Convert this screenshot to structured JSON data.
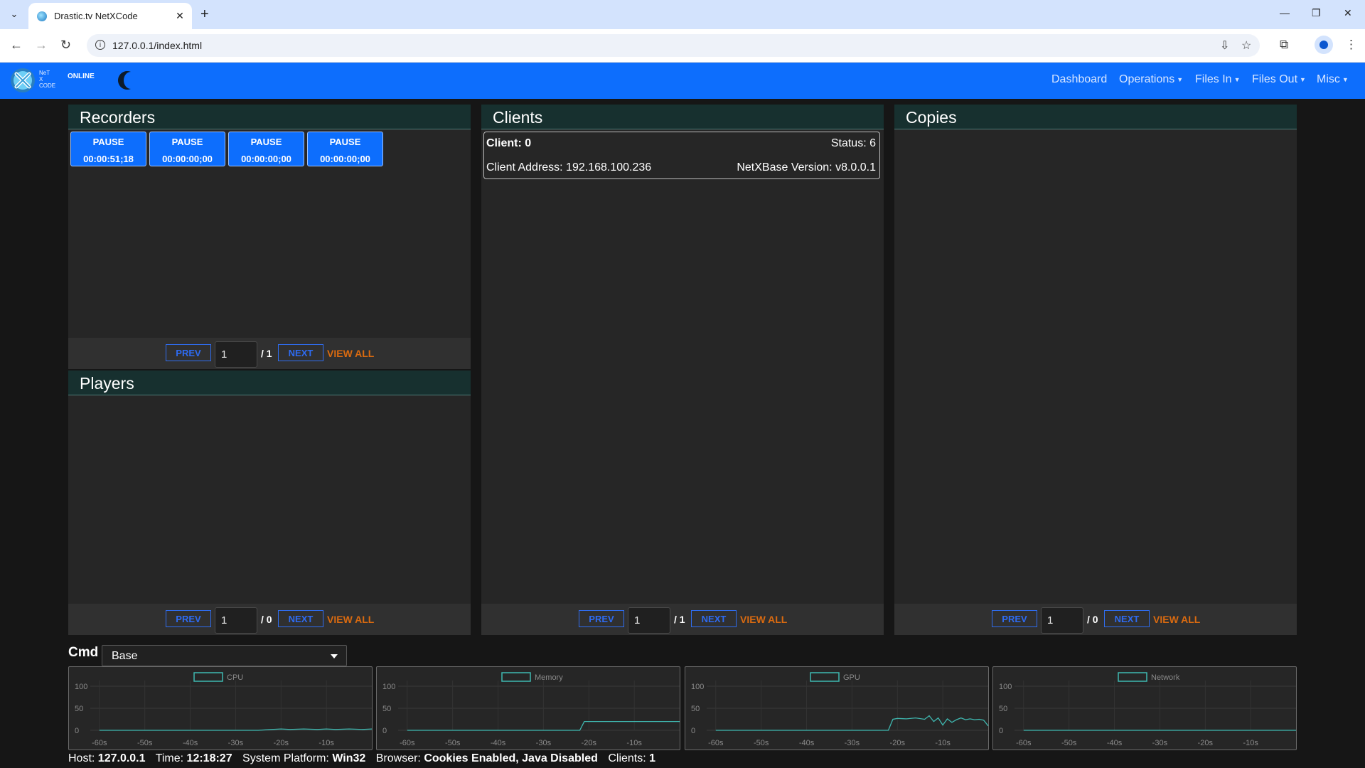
{
  "browser": {
    "tab_title": "Drastic.tv NetXCode",
    "url": "127.0.0.1/index.html"
  },
  "app": {
    "logo_text": [
      "NeT",
      "X",
      "CODE"
    ],
    "status": "ONLINE",
    "nav": {
      "dashboard": "Dashboard",
      "operations": "Operations",
      "files_in": "Files In",
      "files_out": "Files Out",
      "misc": "Misc"
    }
  },
  "recorders": {
    "title": "Recorders",
    "buttons": [
      {
        "state": "PAUSE",
        "timecode": "00:00:51;18"
      },
      {
        "state": "PAUSE",
        "timecode": "00:00:00;00"
      },
      {
        "state": "PAUSE",
        "timecode": "00:00:00;00"
      },
      {
        "state": "PAUSE",
        "timecode": "00:00:00;00"
      }
    ],
    "pager": {
      "prev": "PREV",
      "page": "1",
      "total": "/ 1",
      "next": "NEXT",
      "view_all": "VIEW ALL"
    }
  },
  "players": {
    "title": "Players",
    "pager": {
      "prev": "PREV",
      "page": "1",
      "total": "/ 0",
      "next": "NEXT",
      "view_all": "VIEW ALL"
    }
  },
  "clients": {
    "title": "Clients",
    "card": {
      "client": "Client: 0",
      "status": "Status: 6",
      "address": "Client Address: 192.168.100.236",
      "version": "NetXBase Version: v8.0.0.1"
    },
    "pager": {
      "prev": "PREV",
      "page": "1",
      "total": "/ 1",
      "next": "NEXT",
      "view_all": "VIEW ALL"
    }
  },
  "copies": {
    "title": "Copies",
    "pager": {
      "prev": "PREV",
      "page": "1",
      "total": "/ 0",
      "next": "NEXT",
      "view_all": "VIEW ALL"
    }
  },
  "cmd": {
    "label": "Cmd",
    "selected": "Base"
  },
  "chart_data": [
    {
      "type": "line",
      "series": [
        {
          "name": "CPU",
          "x": [
            -60,
            -55,
            -50,
            -45,
            -40,
            -35,
            -30,
            -25,
            -22,
            -20,
            -18,
            -15,
            -12,
            -10,
            -8,
            -5,
            -2,
            0
          ],
          "values": [
            0,
            0,
            0,
            0,
            0,
            0,
            0,
            0,
            2,
            3,
            2,
            3,
            2,
            3,
            2,
            3,
            2,
            3
          ]
        }
      ],
      "xticks": [
        "-60s",
        "-50s",
        "-40s",
        "-30s",
        "-20s",
        "-10s"
      ],
      "yticks": [
        "100",
        "50",
        "0"
      ],
      "ylim": [
        0,
        100
      ],
      "color": "#3fb8b0"
    },
    {
      "type": "line",
      "series": [
        {
          "name": "Memory",
          "x": [
            -60,
            -50,
            -40,
            -30,
            -22,
            -21,
            -20,
            -10,
            0
          ],
          "values": [
            0,
            0,
            0,
            0,
            0,
            20,
            20,
            20,
            20
          ]
        }
      ],
      "xticks": [
        "-60s",
        "-50s",
        "-40s",
        "-30s",
        "-20s",
        "-10s"
      ],
      "yticks": [
        "100",
        "50",
        "0"
      ],
      "ylim": [
        0,
        100
      ],
      "color": "#3fb8b0"
    },
    {
      "type": "line",
      "series": [
        {
          "name": "GPU",
          "x": [
            -60,
            -50,
            -40,
            -30,
            -22,
            -21,
            -20,
            -18,
            -16,
            -14,
            -13,
            -12,
            -11,
            -10,
            -9,
            -8,
            -7,
            -6,
            -5,
            -4,
            -3,
            -2,
            -1,
            0
          ],
          "values": [
            0,
            0,
            0,
            0,
            0,
            25,
            27,
            26,
            28,
            25,
            33,
            20,
            28,
            12,
            26,
            18,
            24,
            28,
            24,
            26,
            24,
            25,
            23,
            10
          ]
        }
      ],
      "xticks": [
        "-60s",
        "-50s",
        "-40s",
        "-30s",
        "-20s",
        "-10s"
      ],
      "yticks": [
        "100",
        "50",
        "0"
      ],
      "ylim": [
        0,
        100
      ],
      "color": "#3fb8b0"
    },
    {
      "type": "line",
      "series": [
        {
          "name": "Network",
          "x": [
            -60,
            -50,
            -40,
            -30,
            -20,
            -10,
            0
          ],
          "values": [
            0,
            0,
            0,
            0,
            0,
            0,
            0
          ]
        }
      ],
      "xticks": [
        "-60s",
        "-50s",
        "-40s",
        "-30s",
        "-20s",
        "-10s"
      ],
      "yticks": [
        "100",
        "50",
        "0"
      ],
      "ylim": [
        0,
        100
      ],
      "color": "#3fb8b0"
    }
  ],
  "footer": {
    "host_label": "Host:",
    "host": "127.0.0.1",
    "time_label": "Time:",
    "time": "12:18:27",
    "platform_label": "System Platform:",
    "platform": "Win32",
    "browser_label": "Browser:",
    "browser": "Cookies Enabled, Java Disabled",
    "clients_label": "Clients:",
    "clients": "1"
  },
  "colors": {
    "nav_blue": "#0d6efd",
    "panel_header": "#17302f",
    "view_all": "#d96a10",
    "chart_line": "#3fb8b0"
  }
}
